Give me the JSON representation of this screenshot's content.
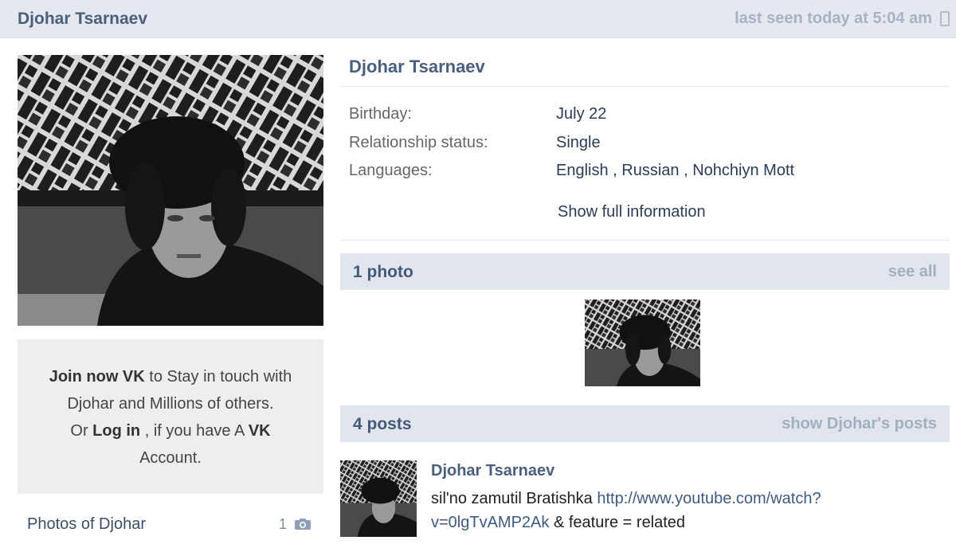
{
  "header": {
    "name": "Djohar Tsarnaev",
    "last_seen": "last seen today at 5:04 am"
  },
  "profile": {
    "name": "Djohar Tsarnaev",
    "info": [
      {
        "label": "Birthday:",
        "value": "July 22"
      },
      {
        "label": "Relationship status:",
        "value": "Single"
      }
    ],
    "languages_label": "Languages:",
    "languages": [
      "English",
      "Russian",
      "Nohchiyn Mott"
    ],
    "language_separator": " , ",
    "show_full": "Show full information"
  },
  "join_box": {
    "join_now": "Join now VK",
    "line1_rest": " to Stay in touch with",
    "line2": "Djohar and Millions of others.",
    "line3_or": "Or ",
    "log_in": "Log in",
    "line3_rest": " , if you have A ",
    "vk": "VK",
    "line4": "Account."
  },
  "photos_of": {
    "label": "Photos of Djohar",
    "count": "1"
  },
  "photos_section": {
    "title": "1 photo",
    "action": "see all"
  },
  "posts_section": {
    "title": "4 posts",
    "action": "show Djohar's posts"
  },
  "post": {
    "author": "Djohar Tsarnaev",
    "text_before": "sil'no zamutil Bratishka ",
    "link_line1": "http://www.youtube.com/watch?",
    "link_line2": "v=0lgTvAMP2Ak",
    "text_after": " & feature = related"
  },
  "colors": {
    "header_bg": "#e5e9ef",
    "section_bg": "#e1e6ee",
    "accent": "#4a5f7c",
    "muted": "#a7b3c2"
  }
}
